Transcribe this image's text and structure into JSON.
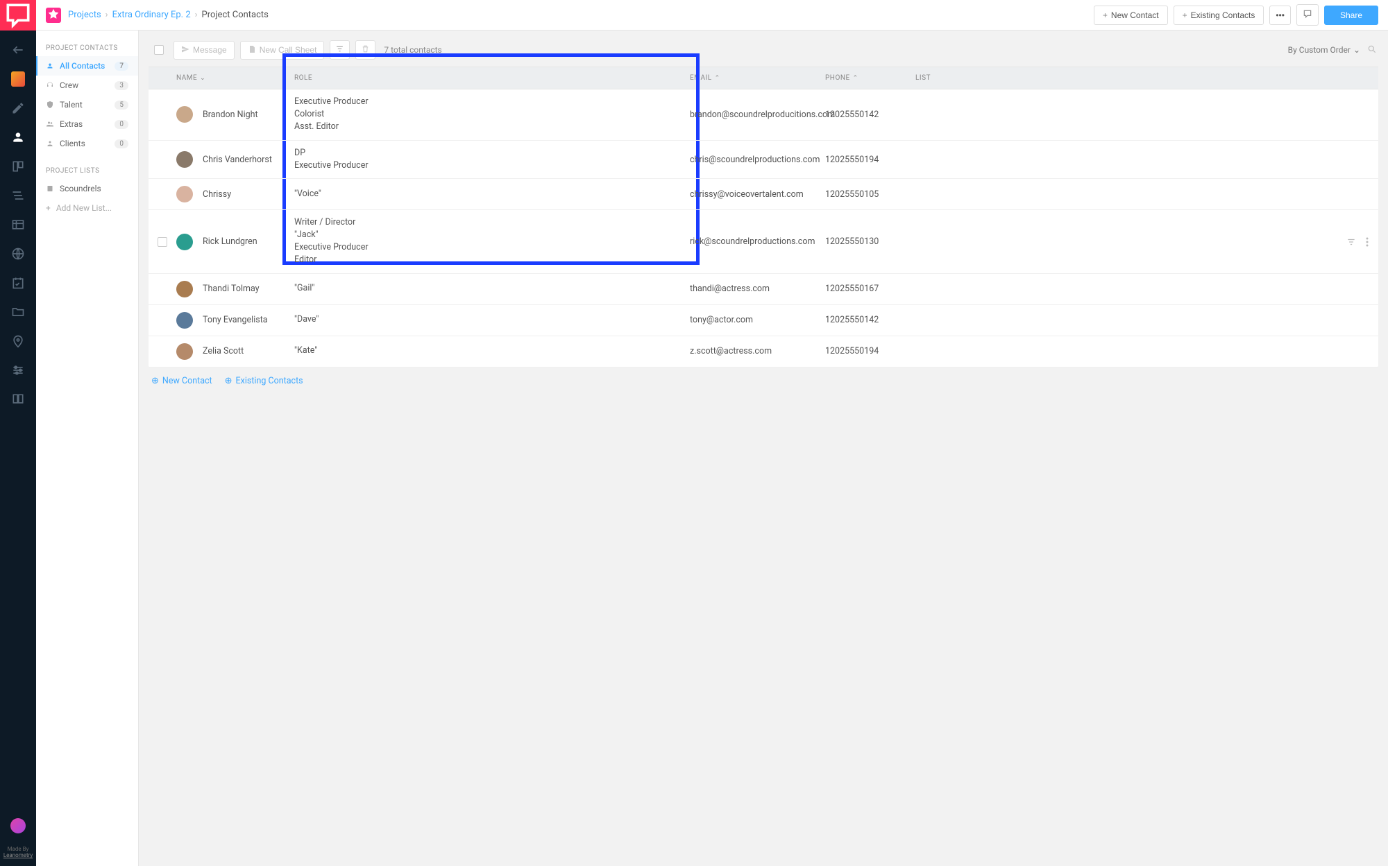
{
  "breadcrumb": {
    "l1": "Projects",
    "l2": "Extra Ordinary Ep. 2",
    "current": "Project Contacts"
  },
  "topbar": {
    "new_contact": "New Contact",
    "existing_contacts": "Existing Contacts",
    "share": "Share"
  },
  "sidebar": {
    "head1": "PROJECT CONTACTS",
    "items": [
      {
        "label": "All Contacts",
        "count": "7"
      },
      {
        "label": "Crew",
        "count": "3"
      },
      {
        "label": "Talent",
        "count": "5"
      },
      {
        "label": "Extras",
        "count": "0"
      },
      {
        "label": "Clients",
        "count": "0"
      }
    ],
    "head2": "PROJECT LISTS",
    "list1": "Scoundrels",
    "add": "Add New List..."
  },
  "toolbar": {
    "message": "Message",
    "new_call_sheet": "New Call Sheet",
    "total": "7 total contacts",
    "sort": "By Custom Order"
  },
  "columns": {
    "name": "NAME",
    "role": "ROLE",
    "email": "EMAIL",
    "phone": "PHONE",
    "list": "LIST"
  },
  "rows": [
    {
      "name": "Brandon Night",
      "roles": [
        "Executive Producer",
        "Colorist",
        "Asst. Editor"
      ],
      "email": "brandon@scoundrelproducitions.com",
      "phone": "12025550142",
      "avatar": "#c9a88a"
    },
    {
      "name": "Chris Vanderhorst",
      "roles": [
        "DP",
        "Executive Producer"
      ],
      "email": "chris@scoundrelproductions.com",
      "phone": "12025550194",
      "avatar": "#8a7a6a"
    },
    {
      "name": "Chrissy",
      "roles": [
        "\"Voice\""
      ],
      "email": "chrissy@voiceovertalent.com",
      "phone": "12025550105",
      "avatar": "#d9b3a0"
    },
    {
      "name": "Rick Lundgren",
      "roles": [
        "Writer / Director",
        "\"Jack\"",
        "Executive Producer",
        "Editor"
      ],
      "email": "rick@scoundrelproductions.com",
      "phone": "12025550130",
      "avatar": "#2a9d8f",
      "hovered": true
    },
    {
      "name": "Thandi Tolmay",
      "roles": [
        "\"Gail\""
      ],
      "email": "thandi@actress.com",
      "phone": "12025550167",
      "avatar": "#a97c50"
    },
    {
      "name": "Tony Evangelista",
      "roles": [
        "\"Dave\""
      ],
      "email": "tony@actor.com",
      "phone": "12025550142",
      "avatar": "#5a7a9a"
    },
    {
      "name": "Zelia Scott",
      "roles": [
        "\"Kate\""
      ],
      "email": "z.scott@actress.com",
      "phone": "12025550194",
      "avatar": "#b58a6a"
    }
  ],
  "footer": {
    "new_contact": "New Contact",
    "existing_contacts": "Existing Contacts"
  },
  "rail_made": {
    "by": "Made By",
    "name": "Leanometry"
  }
}
